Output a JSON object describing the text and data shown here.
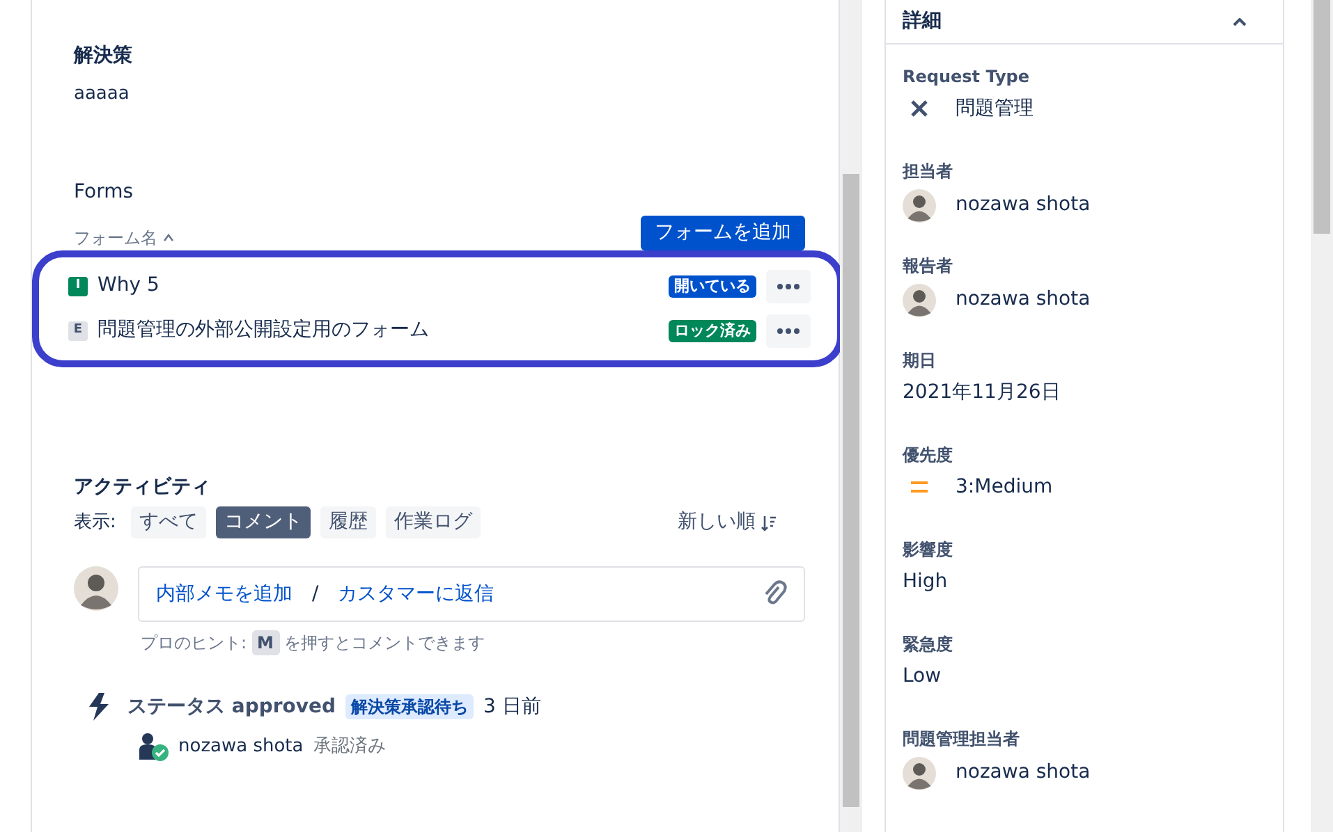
{
  "resolution": {
    "label": "解決策",
    "value": "aaaaa"
  },
  "forms": {
    "title": "Forms",
    "column_header": "フォーム名",
    "add_button": "フォームを追加",
    "highlighted": true,
    "items": [
      {
        "letter": "I",
        "kind": "filled",
        "name": "Why 5",
        "status": "開いている",
        "color": "#0052cc"
      },
      {
        "letter": "E",
        "kind": "outlined",
        "name": "問題管理の外部公開設定用のフォーム",
        "status": "ロック済み",
        "color": "#00875a"
      }
    ]
  },
  "activity": {
    "title": "アクティビティ",
    "filter_label": "表示:",
    "filters": [
      {
        "label": "すべて",
        "selected": false
      },
      {
        "label": "コメント",
        "selected": true
      },
      {
        "label": "履歴",
        "selected": false
      },
      {
        "label": "作業ログ",
        "selected": false
      }
    ],
    "sort": "新しい順",
    "comment": {
      "internal": "内部メモを追加",
      "separator": "/",
      "reply": "カスタマーに返信"
    },
    "tip": {
      "prefix": "プロのヒント:",
      "key": "M",
      "suffix": "を押すとコメントできます"
    },
    "events": [
      {
        "title": "ステータス approved",
        "lozenge": "解決策承認待ち",
        "time": "3 日前",
        "user": "nozawa shota",
        "action": "承認済み"
      }
    ]
  },
  "details": {
    "title": "詳細",
    "expanded": true,
    "fields": [
      {
        "label": "Request Type",
        "kind": "type",
        "value": "問題管理"
      },
      {
        "label": "担当者",
        "kind": "user",
        "value": "nozawa shota"
      },
      {
        "label": "報告者",
        "kind": "user",
        "value": "nozawa shota"
      },
      {
        "label": "期日",
        "kind": "text",
        "value": "2021年11月26日"
      },
      {
        "label": "優先度",
        "kind": "priority",
        "value": "3:Medium"
      },
      {
        "label": "影響度",
        "kind": "text",
        "value": "High"
      },
      {
        "label": "緊急度",
        "kind": "text",
        "value": "Low"
      },
      {
        "label": "問題管理担当者",
        "kind": "user",
        "value": "nozawa shota"
      }
    ]
  }
}
